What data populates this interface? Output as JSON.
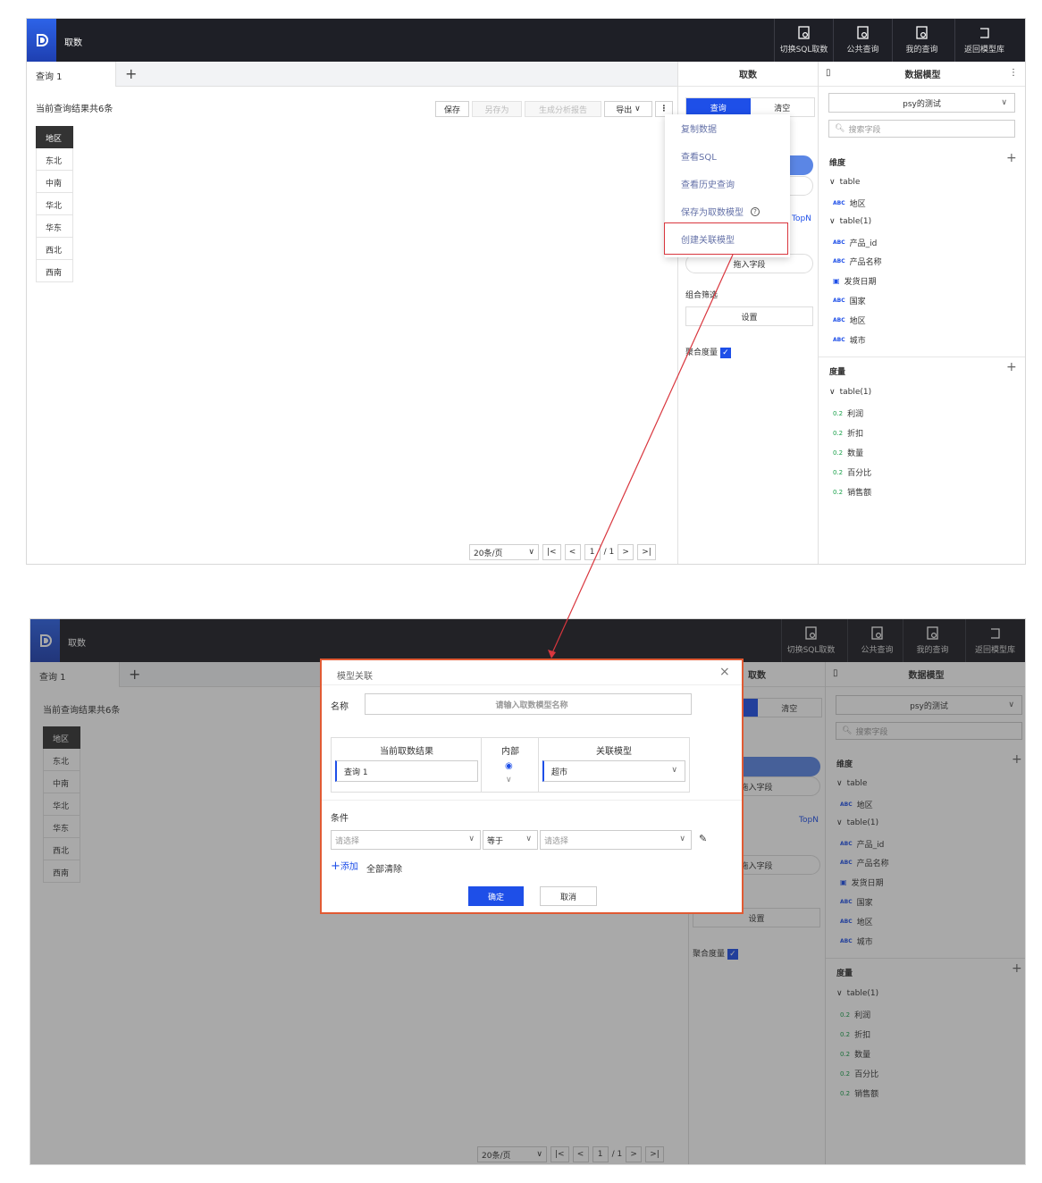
{
  "app": {
    "title": "取数"
  },
  "toolbar": {
    "switch_sql": "切换SQL取数",
    "public_query": "公共查询",
    "my_query": "我的查询",
    "back_model_lib": "返回模型库"
  },
  "tabs": {
    "active": "查询 1",
    "add": "+"
  },
  "result": {
    "summary": "当前查询结果共6条",
    "save": "保存",
    "save_as": "另存为",
    "gen_report": "生成分析报告",
    "export": "导出",
    "more": "⋮",
    "header": "地区",
    "rows": [
      "东北",
      "中南",
      "华北",
      "华东",
      "西北",
      "西南"
    ]
  },
  "pager": {
    "page_size": "20条/页",
    "current": "1",
    "total": "/ 1"
  },
  "query_panel": {
    "title": "取数",
    "query": "查询",
    "clear": "清空",
    "topn": "TopN",
    "drag_field": "拖入字段",
    "combo_filter": "组合筛选",
    "settings": "设置",
    "agg_measure": "聚合度量"
  },
  "more_menu": {
    "items": [
      "复制数据",
      "查看SQL",
      "查看历史查询",
      "保存为取数模型",
      "创建关联模型"
    ]
  },
  "model_panel": {
    "title": "数据模型",
    "model_name": "psy的测试",
    "search_placeholder": "搜索字段",
    "dimension_title": "维度",
    "dim_groups": [
      {
        "name": "table",
        "fields": [
          "地区"
        ]
      },
      {
        "name": "table(1)",
        "fields": [
          "产品_id",
          "产品名称",
          "发货日期",
          "国家",
          "地区",
          "城市"
        ]
      }
    ],
    "abc": "ABC",
    "measure_title": "度量",
    "measure_group": "table(1)",
    "measures": [
      "利润",
      "折扣",
      "数量",
      "百分比",
      "销售额"
    ],
    "num_badge": "0.2"
  },
  "dialog": {
    "title": "模型关联",
    "name_label": "名称",
    "name_placeholder": "请输入取数模型名称",
    "col_current": "当前取数结果",
    "col_join": "内部",
    "col_model": "关联模型",
    "current_value": "查询 1",
    "model_value": "超市",
    "cond_title": "条件",
    "cond_left_placeholder": "请选择",
    "cond_op": "等于",
    "cond_right_placeholder": "请选择",
    "add": "添加",
    "clear_all": "全部清除",
    "ok": "确定",
    "cancel": "取消"
  },
  "colors": {
    "accent": "#1e4fe8",
    "highlight_box": "#d9363e",
    "dialog_border": "#e15a33",
    "topbar": "#1e1f26"
  }
}
